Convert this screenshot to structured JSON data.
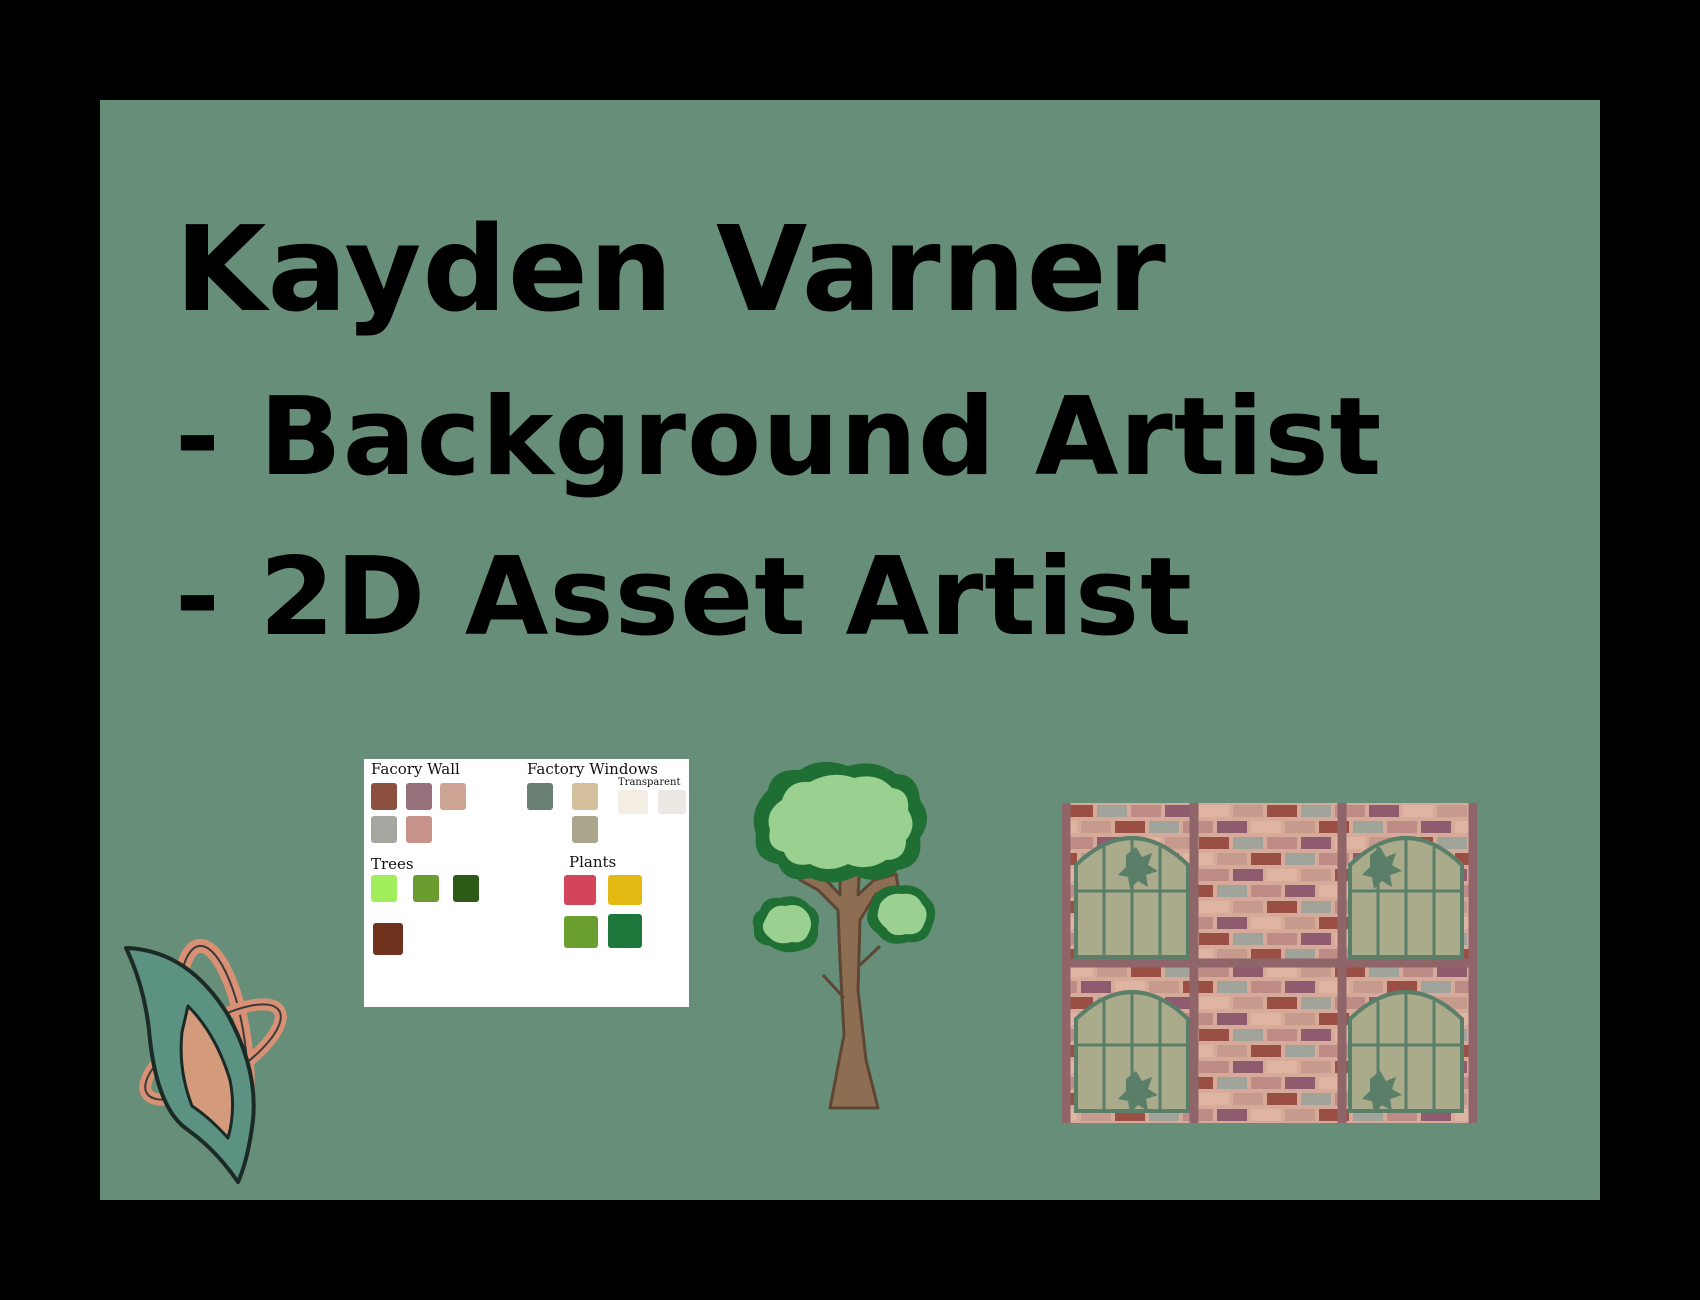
{
  "title": "Kayden Varner",
  "roles": [
    "- Background Artist",
    "- 2D Asset Artist"
  ],
  "colors": {
    "page_background": "#000000",
    "slide_background": "#678e78",
    "text": "#000000"
  },
  "palette": {
    "groups": [
      {
        "label": "Facory Wall",
        "colors": [
          "#8b5040",
          "#96707a",
          "#cda394",
          "#a8a6a0",
          "#c7928a"
        ]
      },
      {
        "label": "Factory Windows",
        "colors": [
          "#6a7f73",
          "#d5c09d",
          "#aaa68c"
        ]
      },
      {
        "label": "Transparent",
        "colors": [
          "#f3ede3",
          "#ebe7e2"
        ]
      },
      {
        "label": "Trees",
        "colors": [
          "#a2ed5c",
          "#6b9c30",
          "#2d5b17",
          "#6f331d"
        ]
      },
      {
        "label": "Plants",
        "colors": [
          "#d3455b",
          "#e3ba14",
          "#6a9f30",
          "#1d763a"
        ]
      }
    ]
  },
  "artwork": {
    "logo": "star-blade-logo-icon",
    "tree": "tree-icon",
    "window_wall": "factory-brick-window-wall"
  }
}
